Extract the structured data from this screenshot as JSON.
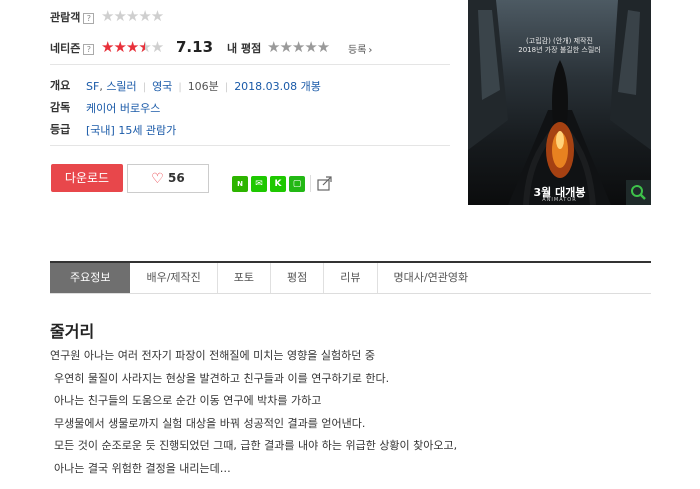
{
  "ratings": {
    "audience_label": "관람객",
    "netizen_label": "네티즌",
    "netizen_score": "7.13",
    "my_rating_label": "내 평점",
    "register_label": "등록",
    "help_mark": "?",
    "audience_stars": 0,
    "netizen_stars": 3.5,
    "my_stars": 0
  },
  "info": {
    "overview_label": "개요",
    "genre_1": "SF",
    "genre_2": "스릴러",
    "country": "영국",
    "runtime": "106분",
    "release": "2018.03.08 개봉",
    "director_label": "감독",
    "director": "케이어 버로우스",
    "grade_label": "등급",
    "grade": "[국내] 15세 관람가"
  },
  "actions": {
    "download_label": "다운로드",
    "like_count": "56"
  },
  "poster": {
    "credit_1": "(고립감) (안개) 제작진",
    "credit_2": "2018년 가장 불길한 스릴러",
    "release_text": "3월 대개봉",
    "small_title": "ANIMATOR"
  },
  "tabs": [
    {
      "label": "주요정보",
      "active": true
    },
    {
      "label": "배우/제작진"
    },
    {
      "label": "포토"
    },
    {
      "label": "평점"
    },
    {
      "label": "리뷰"
    },
    {
      "label": "명대사/연관영화"
    }
  ],
  "synopsis": {
    "heading": "줄거리",
    "lines": [
      "연구원 아나는 여러 전자기 파장이 전해질에 미치는 영향을 실험하던 중",
      "우연히 물질이 사라지는 현상을 발견하고 친구들과 이를 연구하기로 한다.",
      "아나는 친구들의 도움으로 순간 이동 연구에 박차를 가하고",
      "무생물에서 생물로까지 실험 대상을 바꿔 성공적인 결과를 얻어낸다.",
      "모든 것이 순조로운 듯 진행되었던 그때, 급한 결과를 내야 하는 위급한 상황이 찾아오고,",
      "아나는 결국 위험한 결정을 내리는데…"
    ]
  },
  "colors": {
    "accent": "#e8474b",
    "star_on": "#e8303a",
    "tab_active": "#6f6f6f",
    "link": "#1a5aa8"
  }
}
